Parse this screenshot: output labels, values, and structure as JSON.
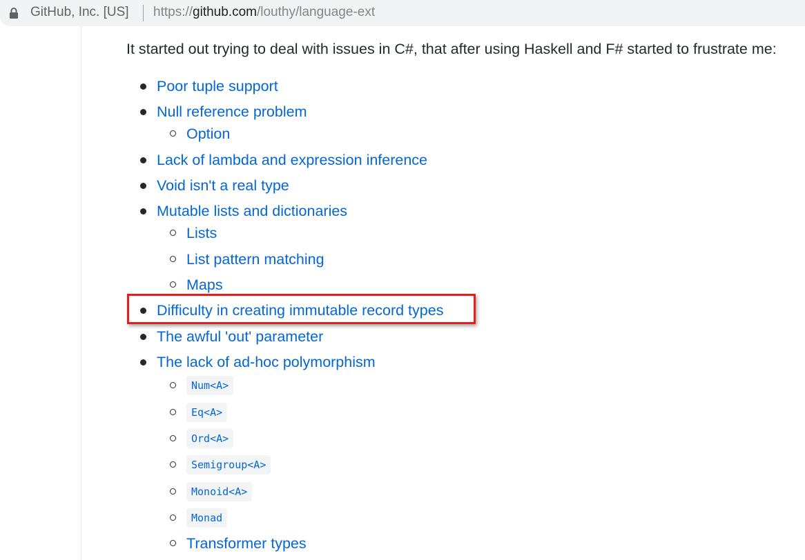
{
  "browser": {
    "site_identity": "GitHub, Inc. [US]",
    "url_scheme": "https://",
    "url_host": "github.com",
    "url_path": "/louthy/language-ext"
  },
  "readme": {
    "intro": "It started out trying to deal with issues in C#, that after using Haskell and F# started to frustrate me:",
    "items": [
      "Poor tuple support",
      "Null reference problem",
      "Lack of lambda and expression inference",
      "Void isn't a real type",
      "Mutable lists and dictionaries",
      "Difficulty in creating immutable record types",
      "The awful 'out' parameter",
      "The lack of ad-hoc polymorphism"
    ],
    "null_ref_sub": [
      "Option"
    ],
    "mutable_sub": [
      "Lists",
      "List pattern matching",
      "Maps"
    ],
    "polymorphism_sub": [
      "Num<A>",
      "Eq<A>",
      "Ord<A>",
      "Semigroup<A>",
      "Monoid<A>",
      "Monad",
      "Transformer types"
    ]
  },
  "colors": {
    "link": "#0366d6",
    "text": "#24292e",
    "highlight_box": "#e21e1e",
    "addressbar_bg": "#f1f3f4"
  },
  "icons": {
    "secure": "lock-icon"
  }
}
